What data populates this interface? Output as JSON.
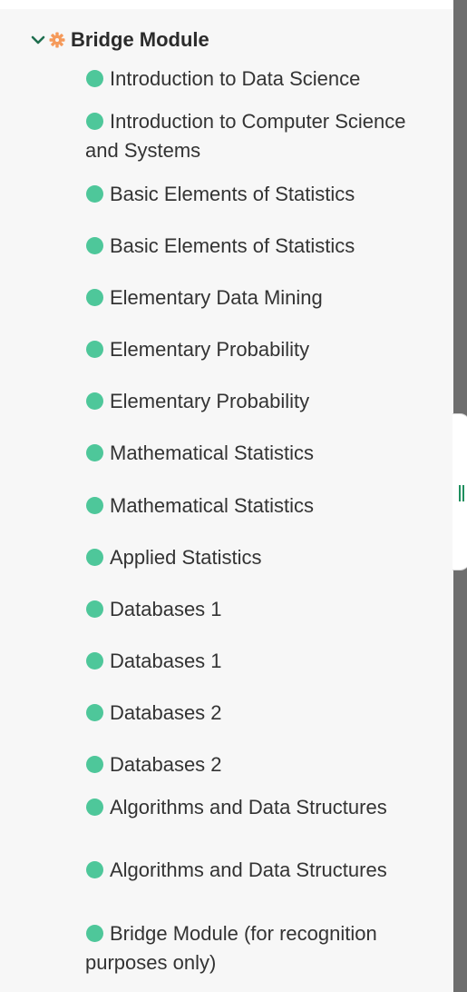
{
  "module": {
    "label": "Bridge Module",
    "chevron_icon": "chevron-down-icon",
    "module_icon": "gear-icon",
    "accent_color": "#f59a5b",
    "chevron_color": "#1f6e4f"
  },
  "item_icon": "status-dot-icon",
  "item_color": "#4ec79a",
  "items": [
    {
      "label": "Introduction to Data Science"
    },
    {
      "label": "Introduction to Computer Science and Systems"
    },
    {
      "label": "Basic Elements of Statistics"
    },
    {
      "label": "Basic Elements of Statistics"
    },
    {
      "label": "Elementary Data Mining"
    },
    {
      "label": "Elementary Probability"
    },
    {
      "label": "Elementary Probability"
    },
    {
      "label": "Mathematical Statistics"
    },
    {
      "label": "Mathematical Statistics"
    },
    {
      "label": "Applied Statistics"
    },
    {
      "label": "Databases 1"
    },
    {
      "label": "Databases 1"
    },
    {
      "label": "Databases 2"
    },
    {
      "label": "Databases 2"
    },
    {
      "label": "Algorithms and Data Structures"
    },
    {
      "label": "Algorithms and Data Structures"
    },
    {
      "label": "Bridge Module (for recognition purposes only)"
    }
  ]
}
